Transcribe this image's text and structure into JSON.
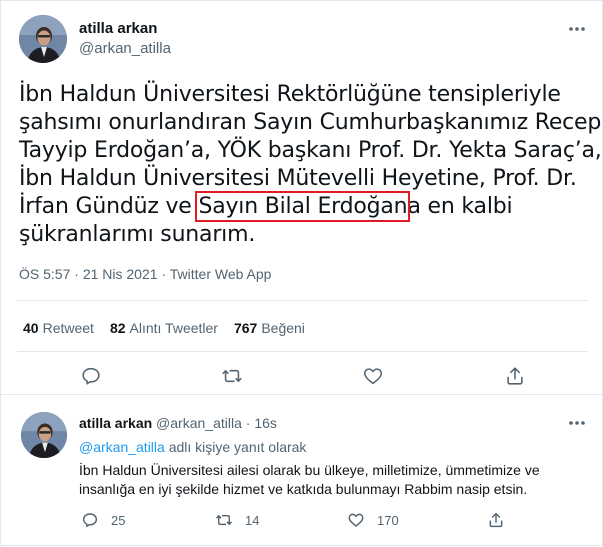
{
  "main_tweet": {
    "display_name": "atilla arkan",
    "handle": "@arkan_atilla",
    "text_lines": [
      "İbn Haldun Üniversitesi Rektörlüğüne tensipleriyle",
      "şahsımı onurlandıran Sayın Cumhurbaşkanımız Recep",
      "Tayyip Erdoğan’a, YÖK başkanı Prof. Dr. Yekta Saraç’a,",
      "İbn Haldun Üniversitesi Mütevelli Heyetine, Prof. Dr.",
      "şükranlarımı sunarım."
    ],
    "line5_before": "İrfan Gündüz ve ",
    "line5_highlight": "Sayın Bilal Erdoğan",
    "line5_after": "a en kalbi",
    "time": "ÖS 5:57",
    "date": "21 Nis 2021",
    "app": "Twitter Web App",
    "separator": "·",
    "stats": {
      "retweets_count": "40",
      "retweets_label": "Retweet",
      "quotes_count": "82",
      "quotes_label": "Alıntı Tweetler",
      "likes_count": "767",
      "likes_label": "Beğeni"
    },
    "icons": [
      "more-icon",
      "reply-icon",
      "retweet-icon",
      "like-icon",
      "share-icon"
    ]
  },
  "reply_tweet": {
    "display_name": "atilla arkan",
    "handle": "@arkan_atilla",
    "time_ago": "16s",
    "separator": "·",
    "replying_mention": "@arkan_atilla",
    "replying_suffix": "adlı kişiye yanıt olarak",
    "text": "İbn Haldun Üniversitesi ailesi olarak bu ülkeye, milletimize, ümmetimize ve insanlığa en iyi şekilde hizmet ve katkıda bulunmayı Rabbim nasip etsin.",
    "reply_count": "25",
    "retweet_count": "14",
    "like_count": "170"
  },
  "colors": {
    "text": "#0f1419",
    "secondary": "#536471",
    "accent": "#1d9bf0",
    "highlight_box": "#e01b24",
    "border": "#e1e8ed"
  }
}
